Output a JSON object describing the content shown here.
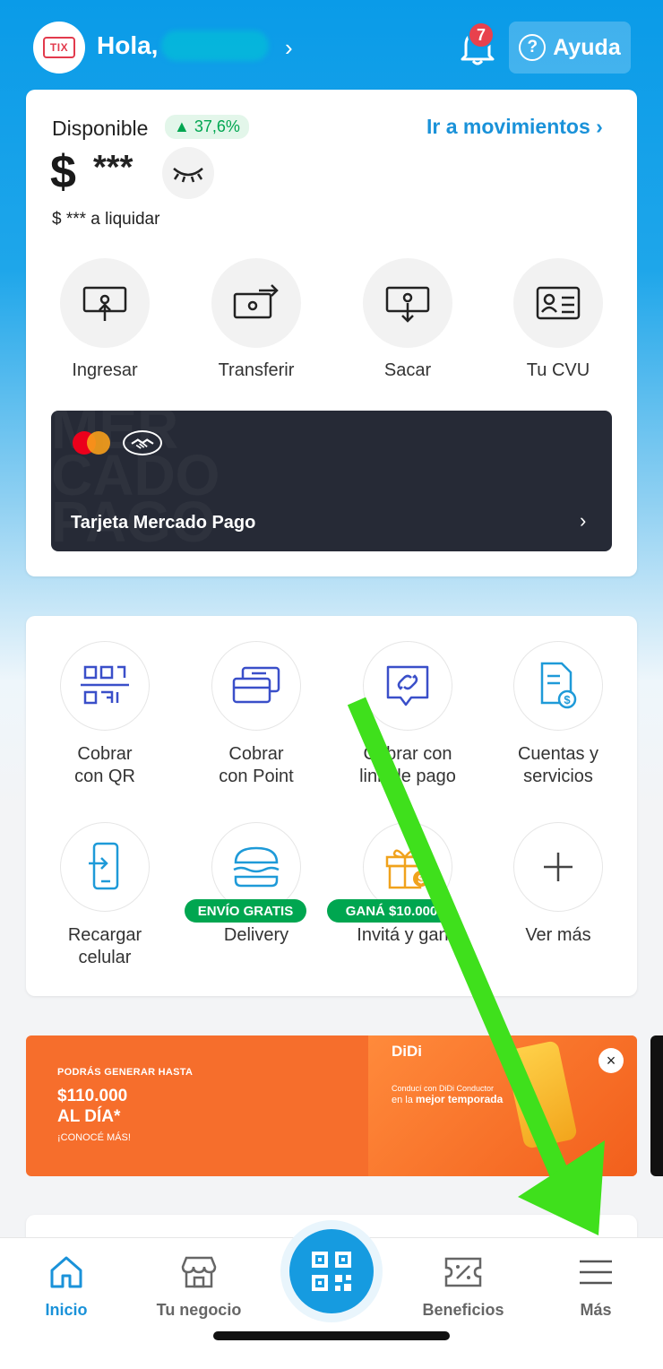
{
  "header": {
    "avatar_text": "TIX",
    "greeting": "Hola,",
    "chevron": "›",
    "notifications_count": "7",
    "help_label": "Ayuda",
    "help_icon_glyph": "?"
  },
  "balance": {
    "title": "Disponible",
    "change": "▲ 37,6%",
    "movements_link": "Ir a movimientos ›",
    "currency": "$",
    "amount_hidden": "***",
    "to_settle": "$ *** a liquidar"
  },
  "actions": [
    {
      "label": "Ingresar",
      "icon": "deposit-icon"
    },
    {
      "label": "Transferir",
      "icon": "transfer-icon"
    },
    {
      "label": "Sacar",
      "icon": "withdraw-icon"
    },
    {
      "label": "Tu CVU",
      "icon": "id-card-icon"
    }
  ],
  "card": {
    "label": "Tarjeta Mercado Pago",
    "watermark": "MER\nCADO\nPAGO",
    "chevron": "›"
  },
  "services": [
    {
      "label": "Cobrar\ncon QR",
      "icon": "qr-code-icon"
    },
    {
      "label": "Cobrar\ncon Point",
      "icon": "point-device-icon"
    },
    {
      "label": "Cobrar con\nlink de pago",
      "icon": "link-icon"
    },
    {
      "label": "Cuentas y\nservicios",
      "icon": "bill-icon"
    },
    {
      "label": "Recargar\ncelular",
      "icon": "phone-recharge-icon"
    },
    {
      "label": "Delivery",
      "icon": "burger-icon",
      "tag": "ENVÍO GRATIS"
    },
    {
      "label": "Invitá y ganá",
      "icon": "gift-icon",
      "tag": "GANÁ $10.000"
    },
    {
      "label": "Ver más",
      "icon": "plus-icon"
    }
  ],
  "banner": {
    "line1": "PODRÁS GENERAR HASTA",
    "line2": "$110.000",
    "line3": "AL DÍA*",
    "line4": "¡CONOCÉ MÁS!",
    "brand": "DiDi",
    "tagline1": "Conducí con DiDi Conductor",
    "tagline2_prefix": "en la",
    "tagline2_bold": "mejor temporada",
    "close": "×"
  },
  "nav": {
    "items": [
      {
        "label": "Inicio",
        "icon": "home-icon",
        "active": true
      },
      {
        "label": "Tu negocio",
        "icon": "store-icon",
        "active": false
      },
      {
        "label": "Beneficios",
        "icon": "ticket-icon",
        "active": false
      },
      {
        "label": "Más",
        "icon": "menu-icon",
        "active": false
      }
    ]
  },
  "colors": {
    "brand_blue": "#0a9be8",
    "link_blue": "#1a92d9",
    "positive_green": "#00a650",
    "annotation_green": "#3fe01c",
    "card_dark": "#262a36",
    "banner_orange": "#f66e2c"
  }
}
